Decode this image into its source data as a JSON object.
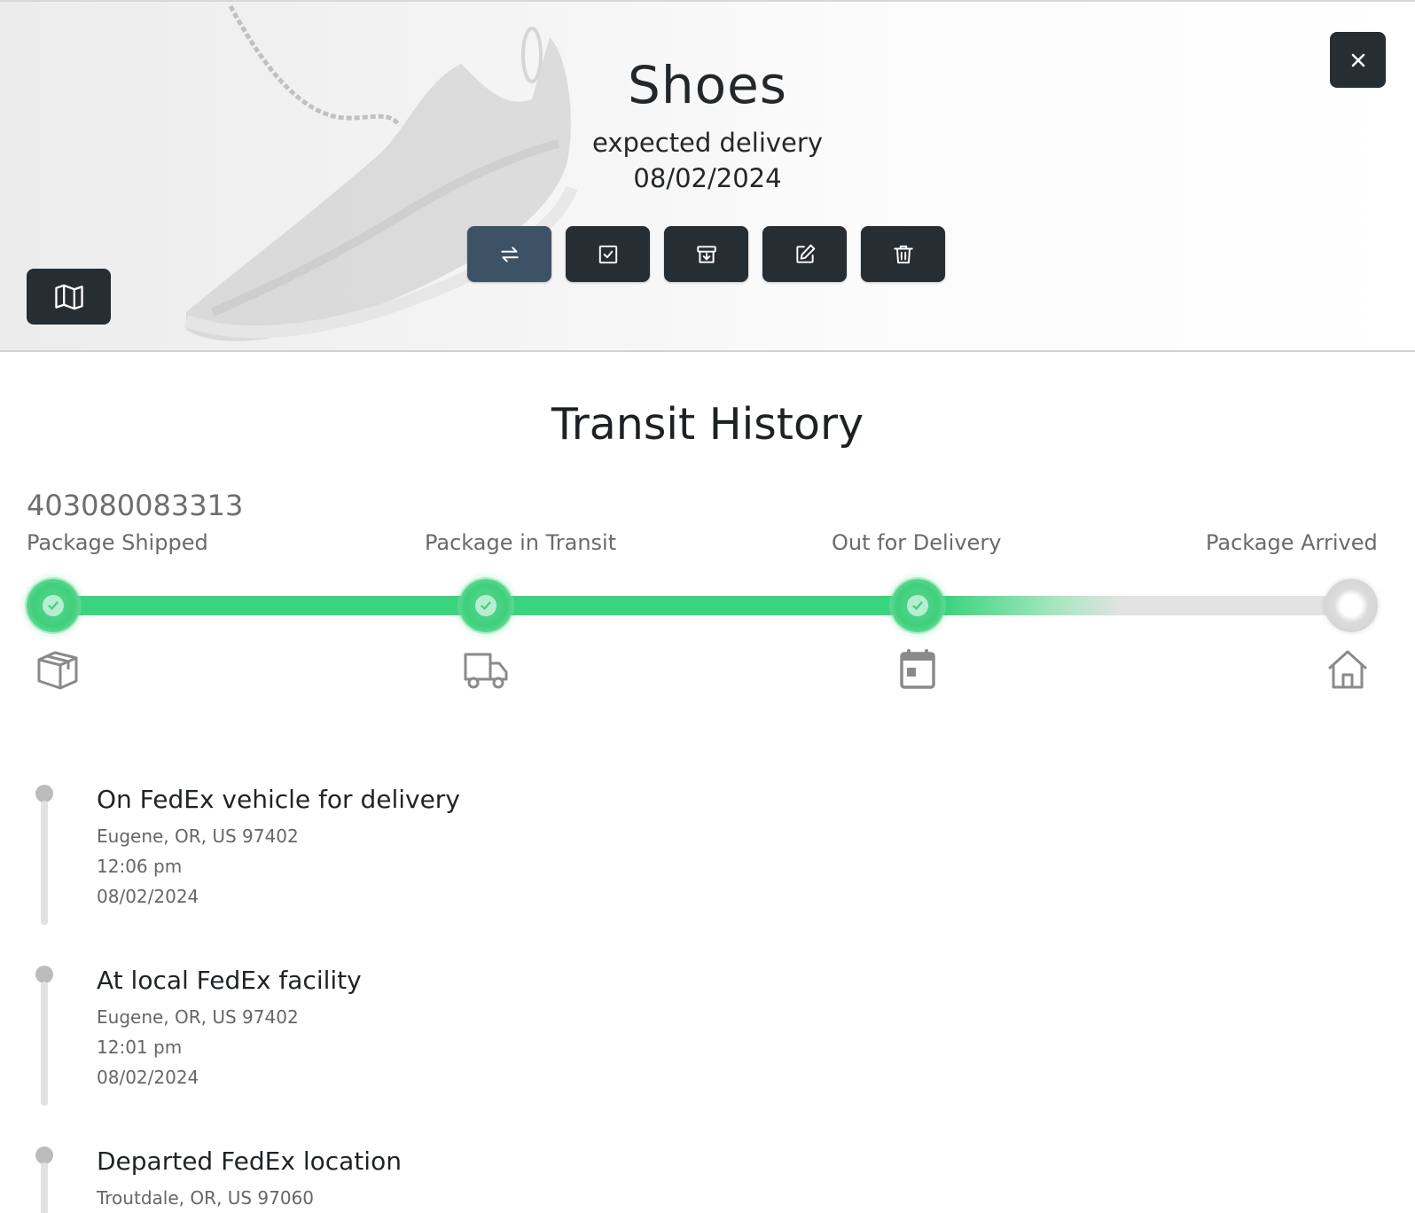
{
  "header": {
    "title": "Shoes",
    "subtitle": "expected delivery",
    "expected_date": "08/02/2024",
    "actions": [
      {
        "name": "swap-button",
        "icon": "swap-arrows-icon",
        "active": true
      },
      {
        "name": "mark-delivered-button",
        "icon": "checkbox-icon",
        "active": false
      },
      {
        "name": "archive-button",
        "icon": "archive-box-icon",
        "active": false
      },
      {
        "name": "edit-button",
        "icon": "edit-pencil-icon",
        "active": false
      },
      {
        "name": "delete-button",
        "icon": "trash-icon",
        "active": false
      }
    ],
    "close_icon": "close-icon",
    "map_icon": "map-icon"
  },
  "transit": {
    "title": "Transit History",
    "tracking_number": "403080083313",
    "stages": [
      {
        "label": "Package Shipped",
        "icon": "package-box-icon",
        "done": true
      },
      {
        "label": "Package in Transit",
        "icon": "truck-icon",
        "done": true
      },
      {
        "label": "Out for Delivery",
        "icon": "calendar-icon",
        "done": true
      },
      {
        "label": "Package Arrived",
        "icon": "home-icon",
        "done": false
      }
    ],
    "progress": 0.85
  },
  "events": [
    {
      "title": "On FedEx vehicle for delivery",
      "location": "Eugene, OR, US 97402",
      "time": "12:06 pm",
      "date": "08/02/2024"
    },
    {
      "title": "At local FedEx facility",
      "location": "Eugene, OR, US 97402",
      "time": "12:01 pm",
      "date": "08/02/2024"
    },
    {
      "title": "Departed FedEx location",
      "location": "Troutdale, OR, US 97060",
      "time": "",
      "date": ""
    }
  ],
  "colors": {
    "accent_green": "#3bd47f",
    "button_dark": "#262d33",
    "button_active": "#3e5265",
    "track_gray": "#e3e3e3"
  }
}
